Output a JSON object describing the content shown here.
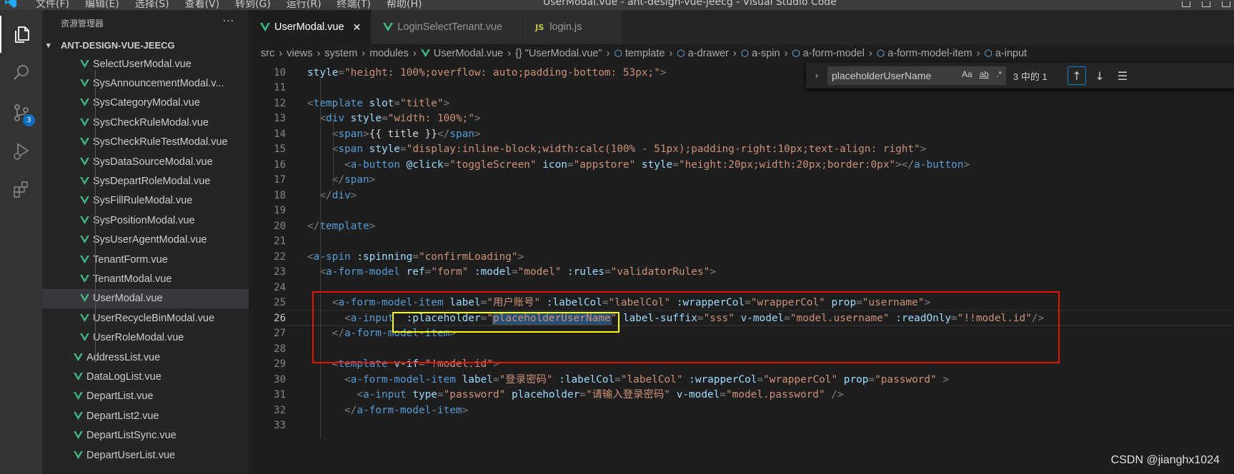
{
  "titlebar": {
    "menu": [
      "文件(F)",
      "编辑(E)",
      "选择(S)",
      "查看(V)",
      "转到(G)",
      "运行(R)",
      "终端(T)",
      "帮助(H)"
    ],
    "title": "UserModal.vue - ant-design-vue-jeecg - Visual Studio Code"
  },
  "activity": {
    "items": [
      "explorer-icon",
      "search-icon",
      "source-control-icon",
      "run-debug-icon",
      "extensions-icon"
    ],
    "scm_badge": "3"
  },
  "sidebar": {
    "header": "资源管理器",
    "more": "···",
    "project": "ANT-DESIGN-VUE-JEECG",
    "nested_files": [
      "SelectUserModal.vue",
      "SysAnnouncementModal.v...",
      "SysCategoryModal.vue",
      "SysCheckRuleModal.vue",
      "SysCheckRuleTestModal.vue",
      "SysDataSourceModal.vue",
      "SysDepartRoleModal.vue",
      "SysFillRuleModal.vue",
      "SysPositionModal.vue",
      "SysUserAgentModal.vue",
      "TenantForm.vue",
      "TenantModal.vue",
      "UserModal.vue",
      "UserRecycleBinModal.vue",
      "UserRoleModal.vue"
    ],
    "files": [
      "AddressList.vue",
      "DataLogList.vue",
      "DepartList.vue",
      "DepartList2.vue",
      "DepartListSync.vue",
      "DepartUserList.vue"
    ],
    "selected": "UserModal.vue"
  },
  "tabs": [
    {
      "label": "UserModal.vue",
      "type": "vue",
      "active": true,
      "close": "✕"
    },
    {
      "label": "LoginSelectTenant.vue",
      "type": "vue",
      "active": false
    },
    {
      "label": "login.js",
      "type": "js",
      "active": false,
      "prefix": "JS"
    }
  ],
  "breadcrumb": [
    "src",
    "views",
    "system",
    "modules",
    "UserModal.vue",
    "{} \"UserModal.vue\"",
    "template",
    "a-drawer",
    "a-spin",
    "a-form-model",
    "a-form-model-item",
    "a-input"
  ],
  "find": {
    "query": "placeholderUserName",
    "opt_case": "Aa",
    "opt_word": "ab",
    "opt_regex": ".*",
    "count": "3 中的 1"
  },
  "editor": {
    "line_numbers": [
      "10",
      "11",
      "12",
      "13",
      "14",
      "15",
      "16",
      "17",
      "18",
      "19",
      "20",
      "21",
      "22",
      "23",
      "24",
      "25",
      "26",
      "27",
      "28",
      "29",
      "30",
      "31",
      "32",
      "33"
    ],
    "current_line": "26",
    "lines": [
      [
        [
          "a",
          "style"
        ],
        [
          "p",
          "="
        ],
        [
          "s",
          "\"height: 100%;overflow: auto;padding-bottom: 53px;\""
        ],
        [
          "p",
          ">"
        ]
      ],
      [],
      [
        [
          "p",
          "<"
        ],
        [
          "t",
          "template"
        ],
        [
          "p",
          " "
        ],
        [
          "a",
          "slot"
        ],
        [
          "p",
          "="
        ],
        [
          "s",
          "\"title\""
        ],
        [
          "p",
          ">"
        ]
      ],
      [
        [
          "p",
          "  <"
        ],
        [
          "t",
          "div"
        ],
        [
          "p",
          " "
        ],
        [
          "a",
          "style"
        ],
        [
          "p",
          "="
        ],
        [
          "s",
          "\"width: 100%;\""
        ],
        [
          "p",
          ">"
        ]
      ],
      [
        [
          "p",
          "    <"
        ],
        [
          "t",
          "span"
        ],
        [
          "p",
          ">"
        ],
        [
          "x",
          "{{ title }}"
        ],
        [
          "p",
          "</"
        ],
        [
          "t",
          "span"
        ],
        [
          "p",
          ">"
        ]
      ],
      [
        [
          "p",
          "    <"
        ],
        [
          "t",
          "span"
        ],
        [
          "p",
          " "
        ],
        [
          "a",
          "style"
        ],
        [
          "p",
          "="
        ],
        [
          "s",
          "\"display:inline-block;width:calc(100% - 51px);padding-right:10px;text-align: right\""
        ],
        [
          "p",
          ">"
        ]
      ],
      [
        [
          "p",
          "      <"
        ],
        [
          "t",
          "a-button"
        ],
        [
          "p",
          " "
        ],
        [
          "a",
          "@click"
        ],
        [
          "p",
          "="
        ],
        [
          "s",
          "\"toggleScreen\""
        ],
        [
          "p",
          " "
        ],
        [
          "a",
          "icon"
        ],
        [
          "p",
          "="
        ],
        [
          "s",
          "\"appstore\""
        ],
        [
          "p",
          " "
        ],
        [
          "a",
          "style"
        ],
        [
          "p",
          "="
        ],
        [
          "s",
          "\"height:20px;width:20px;border:0px\""
        ],
        [
          "p",
          "></"
        ],
        [
          "t",
          "a-button"
        ],
        [
          "p",
          ">"
        ]
      ],
      [
        [
          "p",
          "    </"
        ],
        [
          "t",
          "span"
        ],
        [
          "p",
          ">"
        ]
      ],
      [
        [
          "p",
          "  </"
        ],
        [
          "t",
          "div"
        ],
        [
          "p",
          ">"
        ]
      ],
      [],
      [
        [
          "p",
          "</"
        ],
        [
          "t",
          "template"
        ],
        [
          "p",
          ">"
        ]
      ],
      [],
      [
        [
          "p",
          "<"
        ],
        [
          "t",
          "a-spin"
        ],
        [
          "p",
          " "
        ],
        [
          "a",
          ":spinning"
        ],
        [
          "p",
          "="
        ],
        [
          "s",
          "\"confirmLoading\""
        ],
        [
          "p",
          ">"
        ]
      ],
      [
        [
          "p",
          "  <"
        ],
        [
          "t",
          "a-form-model"
        ],
        [
          "p",
          " "
        ],
        [
          "a",
          "ref"
        ],
        [
          "p",
          "="
        ],
        [
          "s",
          "\"form\""
        ],
        [
          "p",
          " "
        ],
        [
          "a",
          ":model"
        ],
        [
          "p",
          "="
        ],
        [
          "s",
          "\"model\""
        ],
        [
          "p",
          " "
        ],
        [
          "a",
          ":rules"
        ],
        [
          "p",
          "="
        ],
        [
          "s",
          "\"validatorRules\""
        ],
        [
          "p",
          ">"
        ]
      ],
      [],
      [
        [
          "p",
          "    <"
        ],
        [
          "t",
          "a-form-model-item"
        ],
        [
          "p",
          " "
        ],
        [
          "a",
          "label"
        ],
        [
          "p",
          "="
        ],
        [
          "s",
          "\"用户账号\""
        ],
        [
          "p",
          " "
        ],
        [
          "a",
          ":labelCol"
        ],
        [
          "p",
          "="
        ],
        [
          "s",
          "\"labelCol\""
        ],
        [
          "p",
          " "
        ],
        [
          "a",
          ":wrapperCol"
        ],
        [
          "p",
          "="
        ],
        [
          "s",
          "\"wrapperCol\""
        ],
        [
          "p",
          " "
        ],
        [
          "a",
          "prop"
        ],
        [
          "p",
          "="
        ],
        [
          "s",
          "\"username\""
        ],
        [
          "p",
          ">"
        ]
      ],
      [
        [
          "p",
          "      <"
        ],
        [
          "t",
          "a-input"
        ],
        [
          "p",
          "  "
        ],
        [
          "a",
          ":placeholder"
        ],
        [
          "p",
          "="
        ],
        [
          "s",
          "\""
        ],
        [
          "m",
          "placeholderUserName"
        ],
        [
          "s",
          "\""
        ],
        [
          "p",
          " "
        ],
        [
          "a",
          "label-suffix"
        ],
        [
          "p",
          "="
        ],
        [
          "s",
          "\"sss\""
        ],
        [
          "p",
          " "
        ],
        [
          "a",
          "v-model"
        ],
        [
          "p",
          "="
        ],
        [
          "s",
          "\"model.username\""
        ],
        [
          "p",
          " "
        ],
        [
          "a",
          ":readOnly"
        ],
        [
          "p",
          "="
        ],
        [
          "s",
          "\"!!model.id\""
        ],
        [
          "p",
          "/>"
        ]
      ],
      [
        [
          "p",
          "    </"
        ],
        [
          "t",
          "a-form-model-item"
        ],
        [
          "p",
          ">"
        ]
      ],
      [],
      [
        [
          "p",
          "    <"
        ],
        [
          "t",
          "template"
        ],
        [
          "p",
          " "
        ],
        [
          "a",
          "v-if"
        ],
        [
          "p",
          "="
        ],
        [
          "s",
          "\"!model.id\""
        ],
        [
          "p",
          ">"
        ]
      ],
      [
        [
          "p",
          "      <"
        ],
        [
          "t",
          "a-form-model-item"
        ],
        [
          "p",
          " "
        ],
        [
          "a",
          "label"
        ],
        [
          "p",
          "="
        ],
        [
          "s",
          "\"登录密码\""
        ],
        [
          "p",
          " "
        ],
        [
          "a",
          ":labelCol"
        ],
        [
          "p",
          "="
        ],
        [
          "s",
          "\"labelCol\""
        ],
        [
          "p",
          " "
        ],
        [
          "a",
          ":wrapperCol"
        ],
        [
          "p",
          "="
        ],
        [
          "s",
          "\"wrapperCol\""
        ],
        [
          "p",
          " "
        ],
        [
          "a",
          "prop"
        ],
        [
          "p",
          "="
        ],
        [
          "s",
          "\"password\""
        ],
        [
          "p",
          " >"
        ]
      ],
      [
        [
          "p",
          "        <"
        ],
        [
          "t",
          "a-input"
        ],
        [
          "p",
          " "
        ],
        [
          "a",
          "type"
        ],
        [
          "p",
          "="
        ],
        [
          "s",
          "\"password\""
        ],
        [
          "p",
          " "
        ],
        [
          "a",
          "placeholder"
        ],
        [
          "p",
          "="
        ],
        [
          "s",
          "\"请输入登录密码\""
        ],
        [
          "p",
          " "
        ],
        [
          "a",
          "v-model"
        ],
        [
          "p",
          "="
        ],
        [
          "s",
          "\"model.password\""
        ],
        [
          "p",
          " />"
        ]
      ],
      [
        [
          "p",
          "      </"
        ],
        [
          "t",
          "a-form-model-item"
        ],
        [
          "p",
          ">"
        ]
      ],
      []
    ]
  },
  "watermark": "CSDN @jianghx1024",
  "colors": {
    "accent": "#007fd4",
    "vue_green": "#41b883",
    "red_box": "#e51400",
    "yellow_box": "#ffff00",
    "badge": "#0e70c0"
  }
}
